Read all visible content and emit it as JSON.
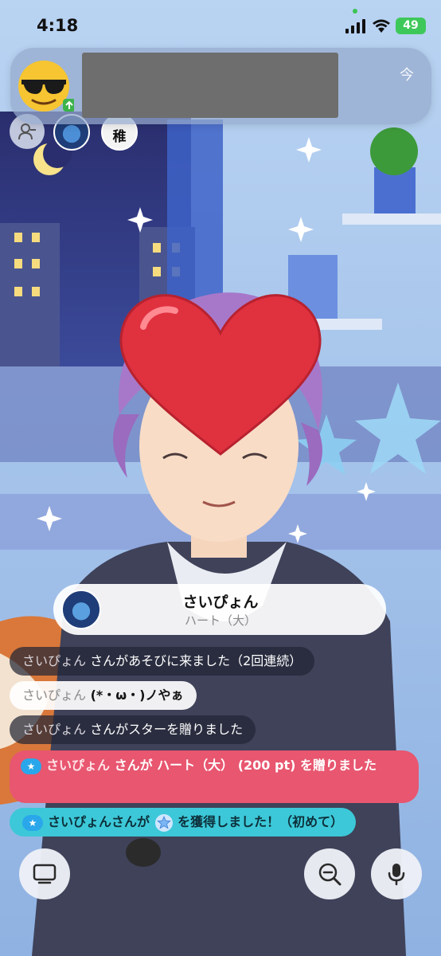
{
  "status_bar": {
    "time": "4:18",
    "battery": "49"
  },
  "notification": {
    "time_label": "今"
  },
  "viewers": {
    "avatar_2_text": "稚"
  },
  "gift": {
    "name": "さいぴょん",
    "item": "ハート（大）"
  },
  "chat": {
    "line1_name": "さいぴょん",
    "line1_text": " さんがあそびに来ました（2回連続）",
    "line2_name": "さいぴょん",
    "line2_text": " (*・ω・)ノやぁ",
    "line3_name": "さいぴょん",
    "line3_text": " さんがスターを贈りました",
    "line4_name": "さいぴょん",
    "line4_text": " さんが ハート（大） (200 pt) を贈りました",
    "line5_text1": "さいぴょんさんが",
    "line5_text2": "を獲得しました！（初めて）"
  },
  "controls": {
    "layout_icon": "screen-icon",
    "zoom_icon": "zoom-out-icon",
    "mic_icon": "microphone-icon"
  },
  "colors": {
    "gift_chat": "#e8566f",
    "achievement_chat": "#3cc8d8",
    "battery": "#3ec85a"
  }
}
